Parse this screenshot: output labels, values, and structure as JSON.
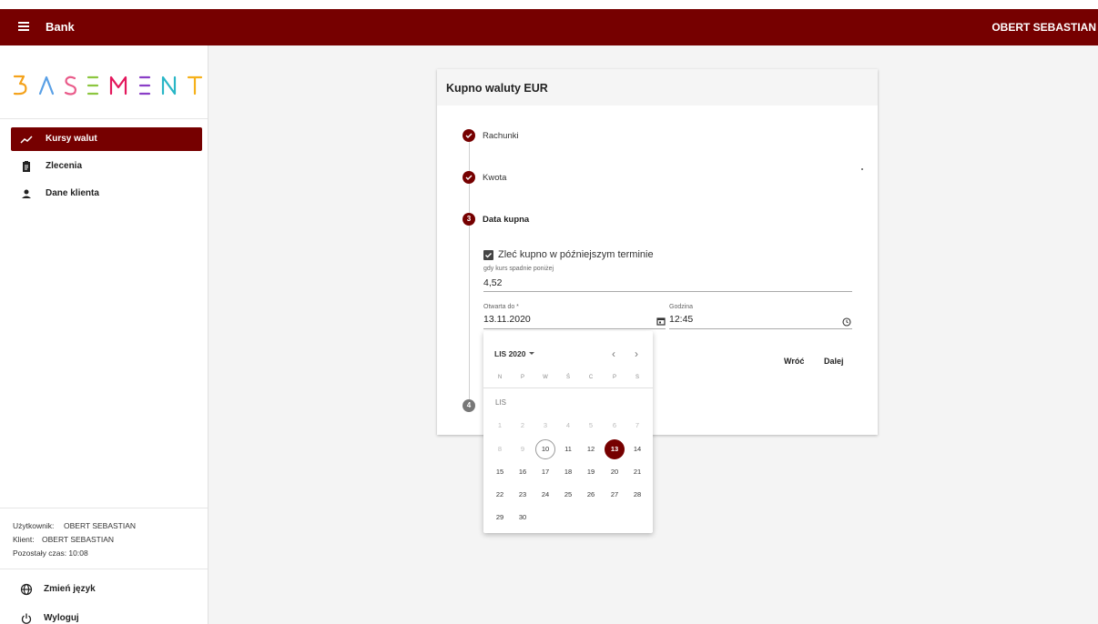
{
  "topbar": {
    "title": "Bank",
    "user": "OBERT SEBASTIAN"
  },
  "brand": {
    "accent": "#760000",
    "logo_letters": [
      "B",
      "A",
      "S",
      "E",
      "M",
      "E",
      "N",
      "T"
    ]
  },
  "sidebar": {
    "items": [
      {
        "label": "Kursy walut",
        "icon": "trending-up-icon",
        "active": true
      },
      {
        "label": "Zlecenia",
        "icon": "clipboard-icon",
        "active": false
      },
      {
        "label": "Dane klienta",
        "icon": "person-icon",
        "active": false
      }
    ],
    "session": {
      "user_label": "Użytkownik:",
      "user_value": "OBERT SEBASTIAN",
      "client_label": "Klient:",
      "client_value": "OBERT SEBASTIAN",
      "time": "Pozostały czas: 10:08"
    },
    "footer": [
      {
        "label": "Zmień język",
        "icon": "globe-icon"
      },
      {
        "label": "Wyloguj",
        "icon": "power-icon"
      }
    ]
  },
  "card": {
    "title": "Kupno waluty EUR",
    "steps": [
      {
        "label": "Rachunki",
        "state": "done"
      },
      {
        "label": "Kwota",
        "state": "done"
      },
      {
        "num": "3",
        "label": "Data kupna",
        "state": "active"
      },
      {
        "num": "4",
        "label": "",
        "state": "pending"
      }
    ],
    "checkbox_label": "Zleć kupno w późniejszym terminie",
    "rate_label": "gdy kurs spadnie poniżej",
    "rate_value": "4,52",
    "date_label": "Otwarta do *",
    "date_value": "13.11.2020",
    "time_label": "Godzina",
    "time_value": "12:45",
    "back": "Wróć",
    "next": "Dalej"
  },
  "picker": {
    "period": "LIS 2020",
    "weekdays": [
      "N",
      "P",
      "W",
      "Ś",
      "C",
      "P",
      "S"
    ],
    "month_label": "LIS",
    "weeks": [
      [
        "1",
        "2",
        "3",
        "4",
        "5",
        "6",
        "7"
      ],
      [
        "8",
        "9",
        "10",
        "11",
        "12",
        "13",
        "14"
      ],
      [
        "15",
        "16",
        "17",
        "18",
        "19",
        "20",
        "21"
      ],
      [
        "22",
        "23",
        "24",
        "25",
        "26",
        "27",
        "28"
      ],
      [
        "29",
        "30"
      ]
    ],
    "disabled_max": 9,
    "today": "10",
    "selected": "13"
  }
}
